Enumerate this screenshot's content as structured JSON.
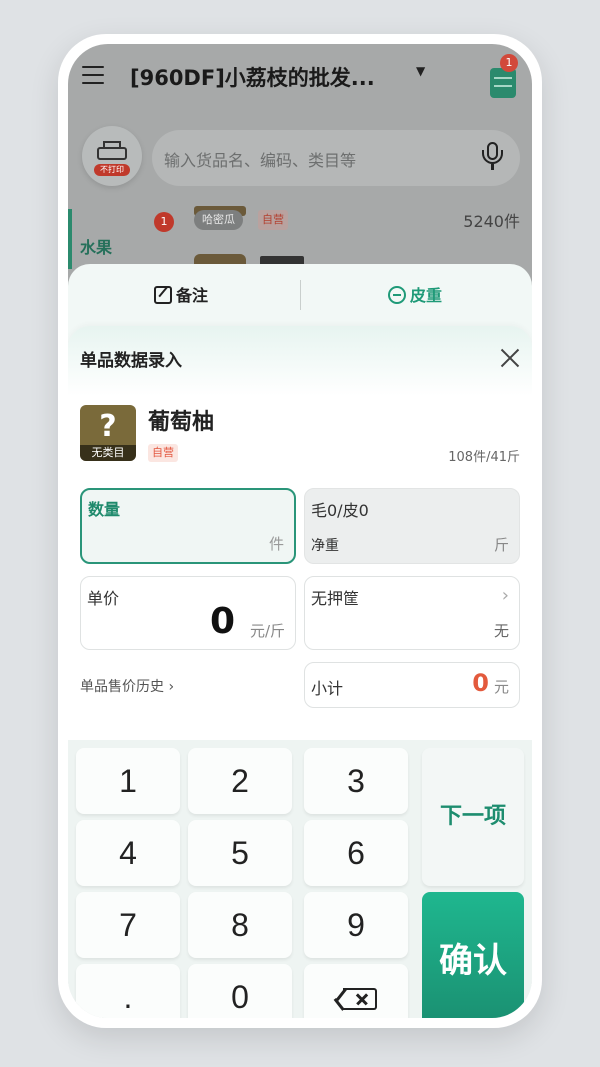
{
  "header": {
    "title": "[960DF]小荔枝的批发...",
    "cart_badge": "1"
  },
  "toolbar": {
    "printer_tag": "不打印",
    "search_placeholder": "输入货品名、编码、类目等"
  },
  "list": {
    "category": "水果",
    "row1": {
      "badge": "1",
      "name": "哈密瓜",
      "tag": "自营",
      "stock": "5240件"
    }
  },
  "tabs": {
    "note": "备注",
    "tare": "皮重"
  },
  "panel": {
    "title": "单品数据录入",
    "product": {
      "image_caption": "无类目",
      "name": "葡萄柚",
      "tag": "自营",
      "stock": "108件/41斤"
    },
    "fields": {
      "qty": {
        "label": "数量",
        "unit": "件"
      },
      "gross": {
        "label": "毛0/皮0",
        "sub": "净重",
        "unit": "斤"
      },
      "price": {
        "label": "单价",
        "value": "0",
        "unit": "元/斤"
      },
      "basket": {
        "label": "无押筐",
        "value": "无"
      },
      "history": "单品售价历史",
      "subtotal": {
        "label": "小计",
        "value": "0",
        "unit": "元"
      }
    }
  },
  "keypad": {
    "keys": [
      "1",
      "2",
      "3",
      "4",
      "5",
      "6",
      "7",
      "8",
      "9",
      ".",
      "0"
    ],
    "next": "下一项",
    "confirm": "确认"
  }
}
